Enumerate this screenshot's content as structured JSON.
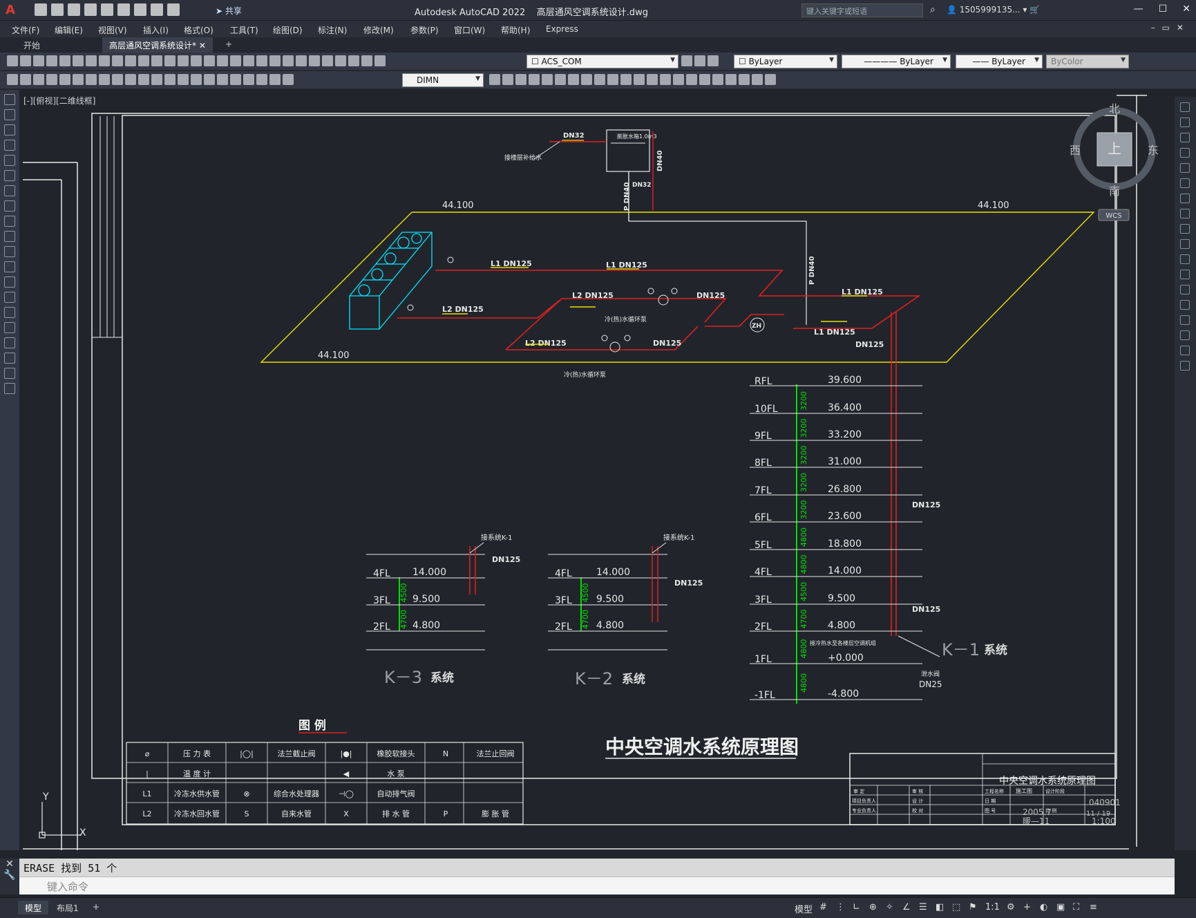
{
  "app": {
    "logo": "A",
    "title": "Autodesk AutoCAD 2022",
    "filename": "高层通风空调系统设计.dwg",
    "share_label": "共享",
    "search_placeholder": "键入关键字或短语",
    "user": "1505999135...",
    "window_controls": [
      "—",
      "☐",
      "✕"
    ]
  },
  "menu": [
    "文件(F)",
    "编辑(E)",
    "视图(V)",
    "插入(I)",
    "格式(O)",
    "工具(T)",
    "绘图(D)",
    "标注(N)",
    "修改(M)",
    "参数(P)",
    "窗口(W)",
    "帮助(H)",
    "Express"
  ],
  "tabs": {
    "start": "开始",
    "active": "高层通风空调系统设计*",
    "add": "+"
  },
  "toolbar": {
    "layer": "ACS_COM",
    "color": "ByLayer",
    "linetype": "ByLayer",
    "lineweight": "ByLayer",
    "plotstyle": "ByColor",
    "dimstyle": "DIMN"
  },
  "viewport": {
    "label": "[-][俯视][二维线框]"
  },
  "viewcube": {
    "north": "北",
    "south": "南",
    "east": "东",
    "west": "西",
    "top": "上",
    "wcs": "WCS"
  },
  "drawing": {
    "title": "中央空调水系统原理图",
    "top_labels": {
      "dn32_a": "DN32",
      "dn32_b": "DN32",
      "dn40_v": "DN40",
      "p_dn40_a": "P DN40",
      "p_dn40_b": "P DN40",
      "tank": "膨胀水箱1.0m3",
      "makeup": "接楼层补给水",
      "elev_left": "44.100",
      "elev_right": "44.100",
      "elev_bottom": "44.100",
      "l1_a": "L1 DN125",
      "l1_b": "L1 DN125",
      "l1_c": "L1 DN125",
      "l1_d": "L1 DN125",
      "l2_a": "L2 DN125",
      "l2_b": "L2 DN125",
      "l2_c": "L2 DN125",
      "dn125_a": "DN125",
      "dn125_b": "DN125",
      "dn125_c": "DN125",
      "pump_a": "冷(热)水循环泵",
      "pump_b": "冷(热)水循环泵",
      "zh": "ZH"
    },
    "k1": {
      "floors": [
        "RFL",
        "10FL",
        "9FL",
        "8FL",
        "7FL",
        "6FL",
        "5FL",
        "4FL",
        "3FL",
        "2FL",
        "1FL",
        "-1FL"
      ],
      "elevations": [
        "39.600",
        "36.400",
        "33.200",
        "31.000",
        "26.800",
        "23.600",
        "18.800",
        "14.000",
        "9.500",
        "4.800",
        "+0.000",
        "-4.800"
      ],
      "spans": [
        "3200",
        "3200",
        "3200",
        "3200",
        "3200",
        "4800",
        "4800",
        "4500",
        "4700",
        "4800",
        "4800"
      ],
      "dn125_labels": [
        "DN125",
        "DN125"
      ],
      "note": "接冷热水至各楼层空调机组",
      "drain": "泄水阀",
      "drain_size": "DN25",
      "system_label": "K－1",
      "system_suffix": "系统"
    },
    "k3": {
      "floors": [
        "4FL",
        "3FL",
        "2FL"
      ],
      "elevations": [
        "14.000",
        "9.500",
        "4.800"
      ],
      "spans": [
        "4500",
        "4700"
      ],
      "note": "接系统K-1",
      "size": "DN125",
      "system_label": "K－3",
      "system_suffix": "系统"
    },
    "k2": {
      "floors": [
        "4FL",
        "3FL",
        "2FL"
      ],
      "elevations": [
        "14.000",
        "9.500",
        "4.800"
      ],
      "spans": [
        "4500",
        "4700"
      ],
      "note": "接系统K-1",
      "size": "DN125",
      "system_label": "K－2",
      "system_suffix": "系统"
    }
  },
  "legend": {
    "title": "图 例",
    "rows": [
      [
        {
          "sym": "⌀",
          "label": "压 力 表"
        },
        {
          "sym": "|◯|",
          "label": "法兰截止阀"
        },
        {
          "sym": "|●|",
          "label": "橡胶软接头"
        },
        {
          "sym": "N",
          "label": "法兰止回阀"
        }
      ],
      [
        {
          "sym": "|",
          "label": "温 度 计"
        },
        {
          "sym": "",
          "label": ""
        },
        {
          "sym": "◀",
          "label": "水    泵"
        },
        {
          "sym": "",
          "label": ""
        }
      ],
      [
        {
          "sym": "L1",
          "label": "冷冻水供水管"
        },
        {
          "sym": "⊗",
          "label": "综合水处理器"
        },
        {
          "sym": "⊣◯",
          "label": "自动排气阀"
        },
        {
          "sym": "",
          "label": ""
        }
      ],
      [
        {
          "sym": "L2",
          "label": "冷冻水回水管"
        },
        {
          "sym": "S",
          "label": "自来水管"
        },
        {
          "sym": "X",
          "label": "排 水 管"
        },
        {
          "sym": "P",
          "label": "膨 胀 管"
        }
      ]
    ]
  },
  "titleblock": {
    "name": "中央空调水系统原理图",
    "date": "2005.7",
    "drawing_no": "040901",
    "sheet": "暖—11",
    "pages": "11 / 19",
    "scale": "1:100",
    "field_labels": [
      "审 定",
      "审 核",
      "项目负责人",
      "专业负责人",
      "设 计",
      "校 对",
      "工程名称",
      "设计阶段",
      "施工图",
      "日 期",
      "图 号",
      "比 例"
    ]
  },
  "command": {
    "history": "ERASE 找到 51 个",
    "placeholder": "键入命令"
  },
  "layout_tabs": [
    "模型",
    "布局1"
  ],
  "status": {
    "model": "模型",
    "scale": "1:1"
  }
}
